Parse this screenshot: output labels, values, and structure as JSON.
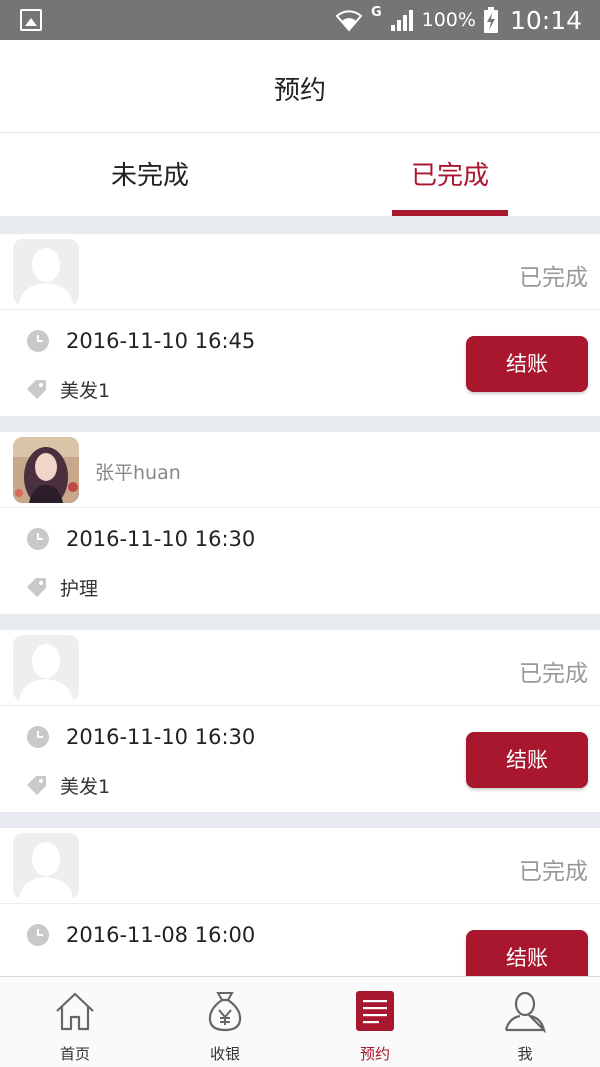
{
  "status_bar": {
    "network": "G",
    "battery": "100%",
    "time": "10:14"
  },
  "header": {
    "title": "预约"
  },
  "tabs": [
    {
      "label": "未完成",
      "active": false
    },
    {
      "label": "已完成",
      "active": true
    }
  ],
  "appointments": [
    {
      "user_name": "",
      "status": "已完成",
      "datetime": "2016-11-10  16:45",
      "service": "美发1",
      "action_label": "结账",
      "has_photo": false
    },
    {
      "user_name": "张平huan",
      "status": "",
      "datetime": "2016-11-10  16:30",
      "service": "护理",
      "action_label": "",
      "has_photo": true
    },
    {
      "user_name": "",
      "status": "已完成",
      "datetime": "2016-11-10  16:30",
      "service": "美发1",
      "action_label": "结账",
      "has_photo": false
    },
    {
      "user_name": "",
      "status": "已完成",
      "datetime": "2016-11-08  16:00",
      "service": "",
      "action_label": "结账",
      "has_photo": false
    }
  ],
  "bottom_nav": [
    {
      "label": "首页",
      "icon": "home-icon",
      "active": false
    },
    {
      "label": "收银",
      "icon": "money-bag-icon",
      "active": false
    },
    {
      "label": "预约",
      "icon": "appointment-list-icon",
      "active": true
    },
    {
      "label": "我",
      "icon": "person-icon",
      "active": false
    }
  ],
  "colors": {
    "accent": "#a8172e",
    "background": "#e8ebf0",
    "status_bar": "#757575"
  }
}
